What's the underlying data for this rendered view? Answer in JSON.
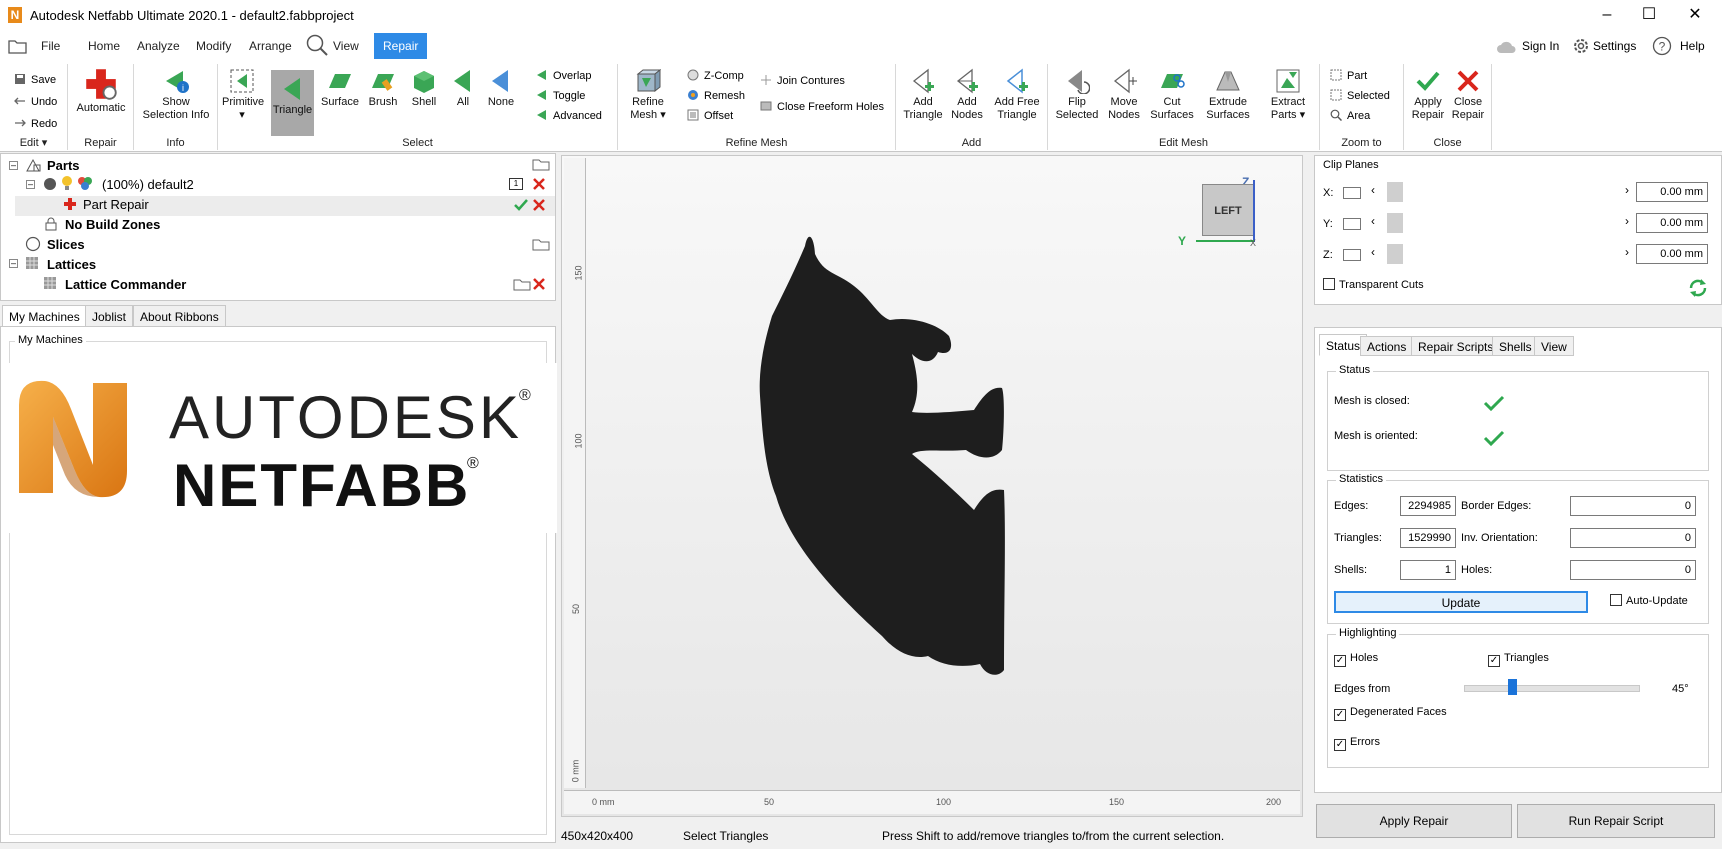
{
  "window": {
    "title": "Autodesk Netfabb Ultimate 2020.1 - default2.fabbproject",
    "logo_letter": "N"
  },
  "menu": {
    "tabs": [
      "File",
      "Home",
      "Analyze",
      "Modify",
      "Arrange",
      "View",
      "Repair"
    ],
    "active": "Repair",
    "sign_in": "Sign In",
    "settings": "Settings",
    "help": "Help"
  },
  "ribbon": {
    "edit": {
      "save": "Save",
      "undo": "Undo",
      "redo": "Redo",
      "label": "Edit"
    },
    "repair": {
      "automatic": "Automatic",
      "label": "Repair"
    },
    "info": {
      "show": "Show",
      "selection_info": "Selection Info",
      "label": "Info"
    },
    "select": {
      "buttons": [
        "Primitive",
        "Triangle",
        "Surface",
        "Brush",
        "Shell",
        "All",
        "None"
      ],
      "overlap": "Overlap",
      "toggle": "Toggle",
      "advanced": "Advanced",
      "label": "Select"
    },
    "refine": {
      "refine": "Refine",
      "mesh": "Mesh",
      "zcomp": "Z-Comp",
      "remesh": "Remesh",
      "offset": "Offset",
      "join": "Join Contures",
      "close_freeform": "Close Freeform Holes",
      "label": "Refine Mesh"
    },
    "add": {
      "add_tri_1": "Add",
      "add_tri_2": "Triangle",
      "add_nodes_1": "Add",
      "add_nodes_2": "Nodes",
      "add_free_1": "Add Free",
      "add_free_2": "Triangle",
      "label": "Add"
    },
    "edit_mesh": {
      "flip_1": "Flip",
      "flip_2": "Selected",
      "move_1": "Move",
      "move_2": "Nodes",
      "cut_1": "Cut",
      "cut_2": "Surfaces",
      "extrude_1": "Extrude",
      "extrude_2": "Surfaces",
      "extract_1": "Extract",
      "extract_2": "Parts",
      "label": "Edit Mesh"
    },
    "zoom": {
      "part": "Part",
      "selected": "Selected",
      "area": "Area",
      "label": "Zoom to"
    },
    "close": {
      "apply_1": "Apply",
      "apply_2": "Repair",
      "close_1": "Close",
      "close_2": "Repair",
      "label": "Close"
    }
  },
  "tree": {
    "parts": "Parts",
    "default2": "(100%) default2",
    "part_repair": "Part Repair",
    "no_build": "No Build Zones",
    "slices": "Slices",
    "lattices": "Lattices",
    "lattice_cmd": "Lattice Commander",
    "count_badge": "1"
  },
  "left_tabs": [
    "My Machines",
    "Joblist",
    "About Ribbons"
  ],
  "machines": {
    "group_label": "My Machines",
    "logo_line1": "AUTODESK",
    "logo_line2": "NETFABB",
    "reg": "®"
  },
  "viewport": {
    "view_cube": "LEFT",
    "axis_z": "Z",
    "axis_y": "Y",
    "axis_x": "X",
    "v_ticks": [
      "150",
      "100",
      "50",
      "0 mm"
    ],
    "h_ticks": [
      "0 mm",
      "50",
      "100",
      "150",
      "200"
    ]
  },
  "statusbar": {
    "dims": "450x420x400",
    "mode": "Select Triangles",
    "hint": "Press Shift to add/remove triangles to/from the current selection."
  },
  "clip": {
    "title": "Clip Planes",
    "x_label": "X:",
    "y_label": "Y:",
    "z_label": "Z:",
    "x_val": "0.00 mm",
    "y_val": "0.00 mm",
    "z_val": "0.00 mm",
    "transparent": "Transparent Cuts"
  },
  "rtabs": [
    "Status",
    "Actions",
    "Repair Scripts",
    "Shells",
    "View"
  ],
  "status": {
    "title": "Status",
    "closed": "Mesh is closed:",
    "oriented": "Mesh is oriented:"
  },
  "stats": {
    "title": "Statistics",
    "edges_label": "Edges:",
    "edges": "2294985",
    "triangles_label": "Triangles:",
    "triangles": "1529990",
    "shells_label": "Shells:",
    "shells": "1",
    "border_label": "Border Edges:",
    "border": "0",
    "inv_label": "Inv. Orientation:",
    "inv": "0",
    "holes_label": "Holes:",
    "holes": "0",
    "update": "Update",
    "auto_update": "Auto-Update"
  },
  "highlight": {
    "title": "Highlighting",
    "holes": "Holes",
    "triangles": "Triangles",
    "edges_from": "Edges from",
    "edges_angle": "45°",
    "edges_level": 0.27,
    "degenerated": "Degenerated Faces",
    "errors": "Errors"
  },
  "bottom_buttons": {
    "apply": "Apply Repair",
    "run": "Run Repair Script"
  },
  "colors": {
    "accent": "#2e8ae6",
    "green": "#2fa84f",
    "red": "#d9261c",
    "model": "#1e1e1e"
  }
}
